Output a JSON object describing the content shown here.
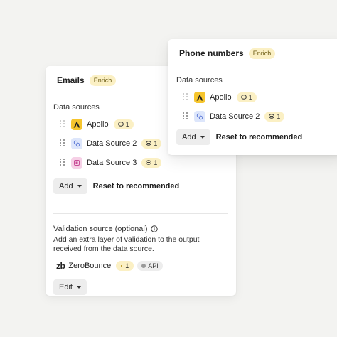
{
  "emails": {
    "title": "Emails",
    "badge": "Enrich",
    "section_label": "Data sources",
    "sources": [
      {
        "name": "Apollo",
        "count": "1",
        "logo": "apollo-logo"
      },
      {
        "name": "Data Source 2",
        "count": "1",
        "logo": "data-source-2-logo"
      },
      {
        "name": "Data Source 3",
        "count": "1",
        "logo": "data-source-3-logo"
      }
    ],
    "add_label": "Add",
    "reset_label": "Reset to recommended",
    "validation": {
      "title": "Validation source (optional)",
      "description": "Add an extra layer of validation to the output received from the data source.",
      "provider_logo": "zb",
      "provider_name": "ZeroBounce",
      "count": "1",
      "api_label": "API",
      "edit_label": "Edit"
    }
  },
  "phone": {
    "title": "Phone numbers",
    "badge": "Enrich",
    "section_label": "Data sources",
    "sources": [
      {
        "name": "Apollo",
        "count": "1",
        "logo": "apollo-logo"
      },
      {
        "name": "Data Source 2",
        "count": "1",
        "logo": "data-source-2-logo"
      }
    ],
    "add_label": "Add",
    "reset_label": "Reset to recommended"
  },
  "colors": {
    "background": "#f3f3f1",
    "badge": "#fbf0c4",
    "apollo": "#f6c52d",
    "button": "#ededed"
  }
}
